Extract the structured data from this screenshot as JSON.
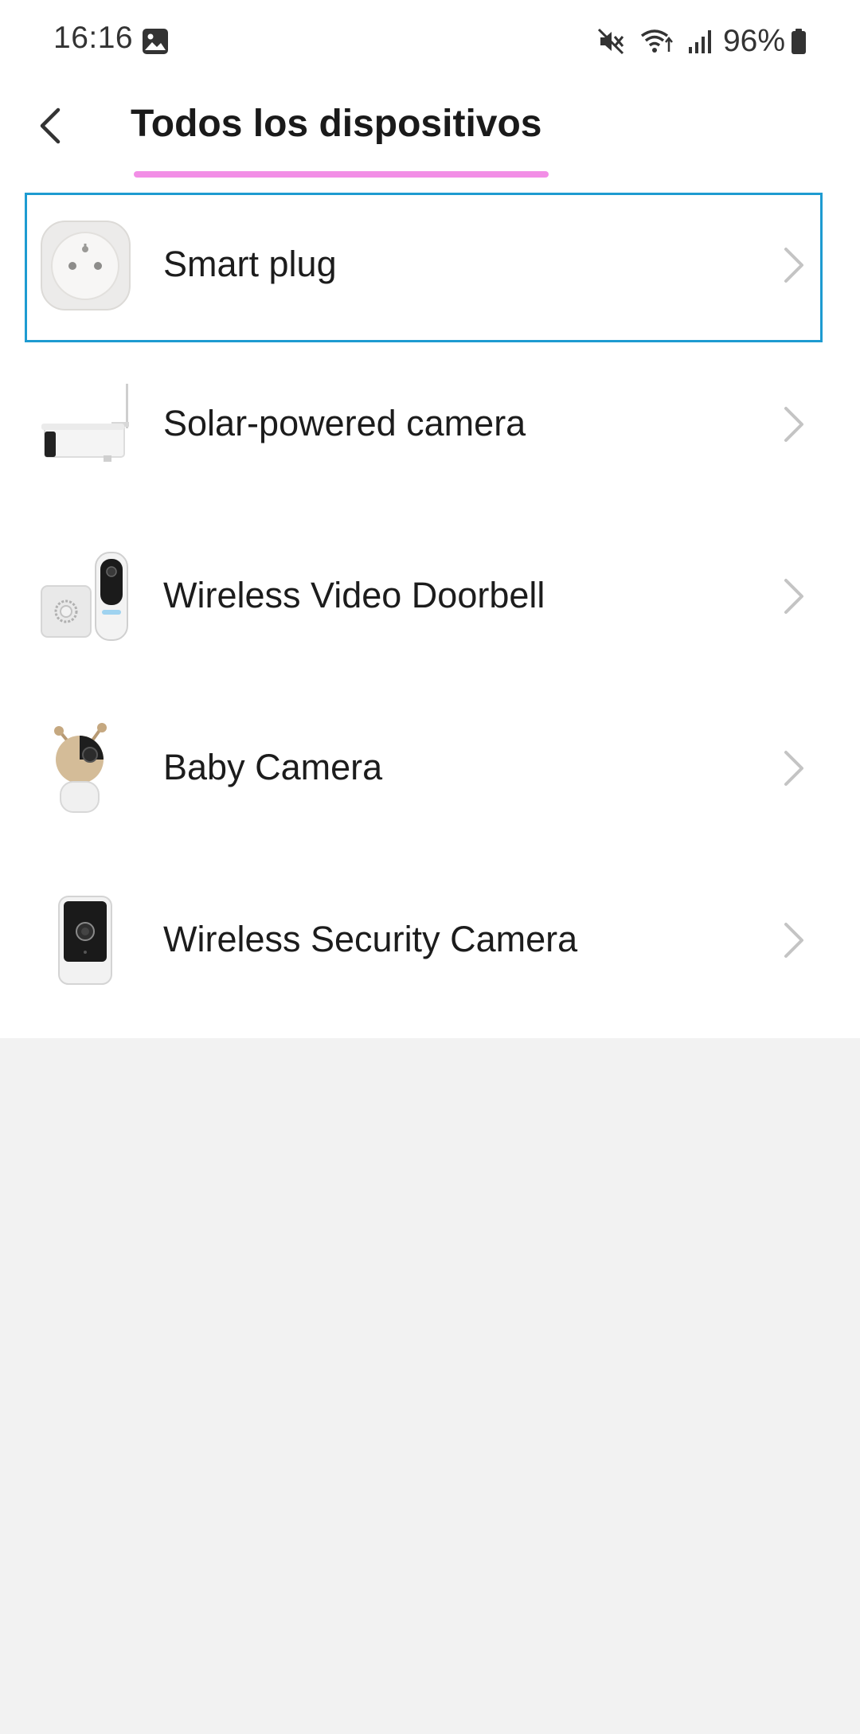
{
  "status_bar": {
    "time": "16:16",
    "battery": "96%",
    "icons": [
      "gallery-icon",
      "mute-icon",
      "wifi-icon",
      "signal-icon",
      "battery-icon"
    ]
  },
  "header": {
    "title": "Todos los dispositivos",
    "back_icon": "chevron-left-icon"
  },
  "colors": {
    "underline": "#f28ee6",
    "selection_border": "#1e9bd1",
    "chevron": "#c4c4c4",
    "empty_area": "#f2f2f2"
  },
  "devices": [
    {
      "label": "Smart plug",
      "icon": "smart-plug-icon",
      "selected": true
    },
    {
      "label": "Solar-powered camera",
      "icon": "solar-camera-icon",
      "selected": false
    },
    {
      "label": "Wireless Video Doorbell",
      "icon": "doorbell-icon",
      "selected": false
    },
    {
      "label": "Baby Camera",
      "icon": "baby-camera-icon",
      "selected": false
    },
    {
      "label": "Wireless Security Camera",
      "icon": "security-camera-icon",
      "selected": false
    }
  ]
}
